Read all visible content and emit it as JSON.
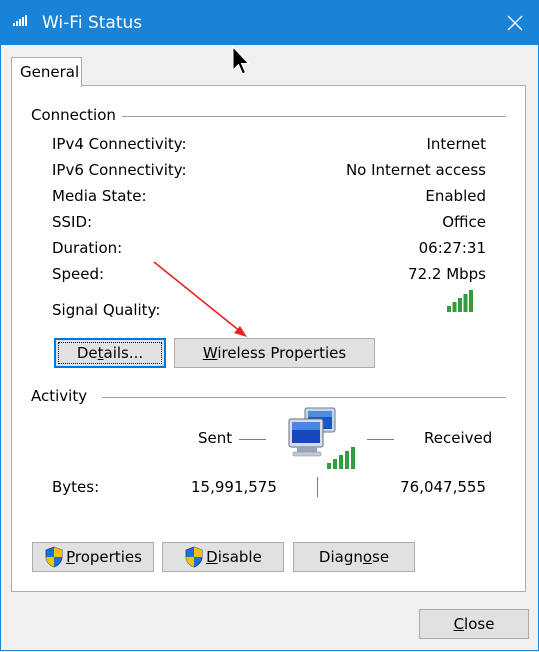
{
  "window": {
    "title": "Wi-Fi Status",
    "icon": "wifi-signal-icon"
  },
  "tabs": [
    {
      "label": "General",
      "selected": true
    }
  ],
  "connection": {
    "section_title": "Connection",
    "rows": [
      {
        "label": "IPv4 Connectivity:",
        "value": "Internet"
      },
      {
        "label": "IPv6 Connectivity:",
        "value": "No Internet access"
      },
      {
        "label": "Media State:",
        "value": "Enabled"
      },
      {
        "label": "SSID:",
        "value": "Office"
      },
      {
        "label": "Duration:",
        "value": "06:27:31"
      },
      {
        "label": "Speed:",
        "value": "72.2 Mbps"
      }
    ],
    "signal_quality_label": "Signal Quality:",
    "signal_bars": 5,
    "details_button": {
      "pre": "De",
      "accel": "t",
      "post": "ails..."
    },
    "wireless_button": {
      "pre": "",
      "accel": "W",
      "post": "ireless Properties"
    }
  },
  "activity": {
    "section_title": "Activity",
    "sent_label": "Sent",
    "received_label": "Received",
    "bytes_label": "Bytes:",
    "bytes_sent": "15,991,575",
    "bytes_received": "76,047,555"
  },
  "actions": {
    "properties_button": {
      "pre": "",
      "accel": "P",
      "post": "roperties"
    },
    "disable_button": {
      "pre": "",
      "accel": "D",
      "post": "isable"
    },
    "diagnose_button": {
      "pre": "Diagn",
      "accel": "o",
      "post": "se"
    }
  },
  "footer": {
    "close_button": {
      "pre": "",
      "accel": "C",
      "post": "lose"
    }
  },
  "colors": {
    "titlebar": "#1883d7",
    "signal_green": "#2e9e3e",
    "annotation_arrow": "#e8211f"
  }
}
